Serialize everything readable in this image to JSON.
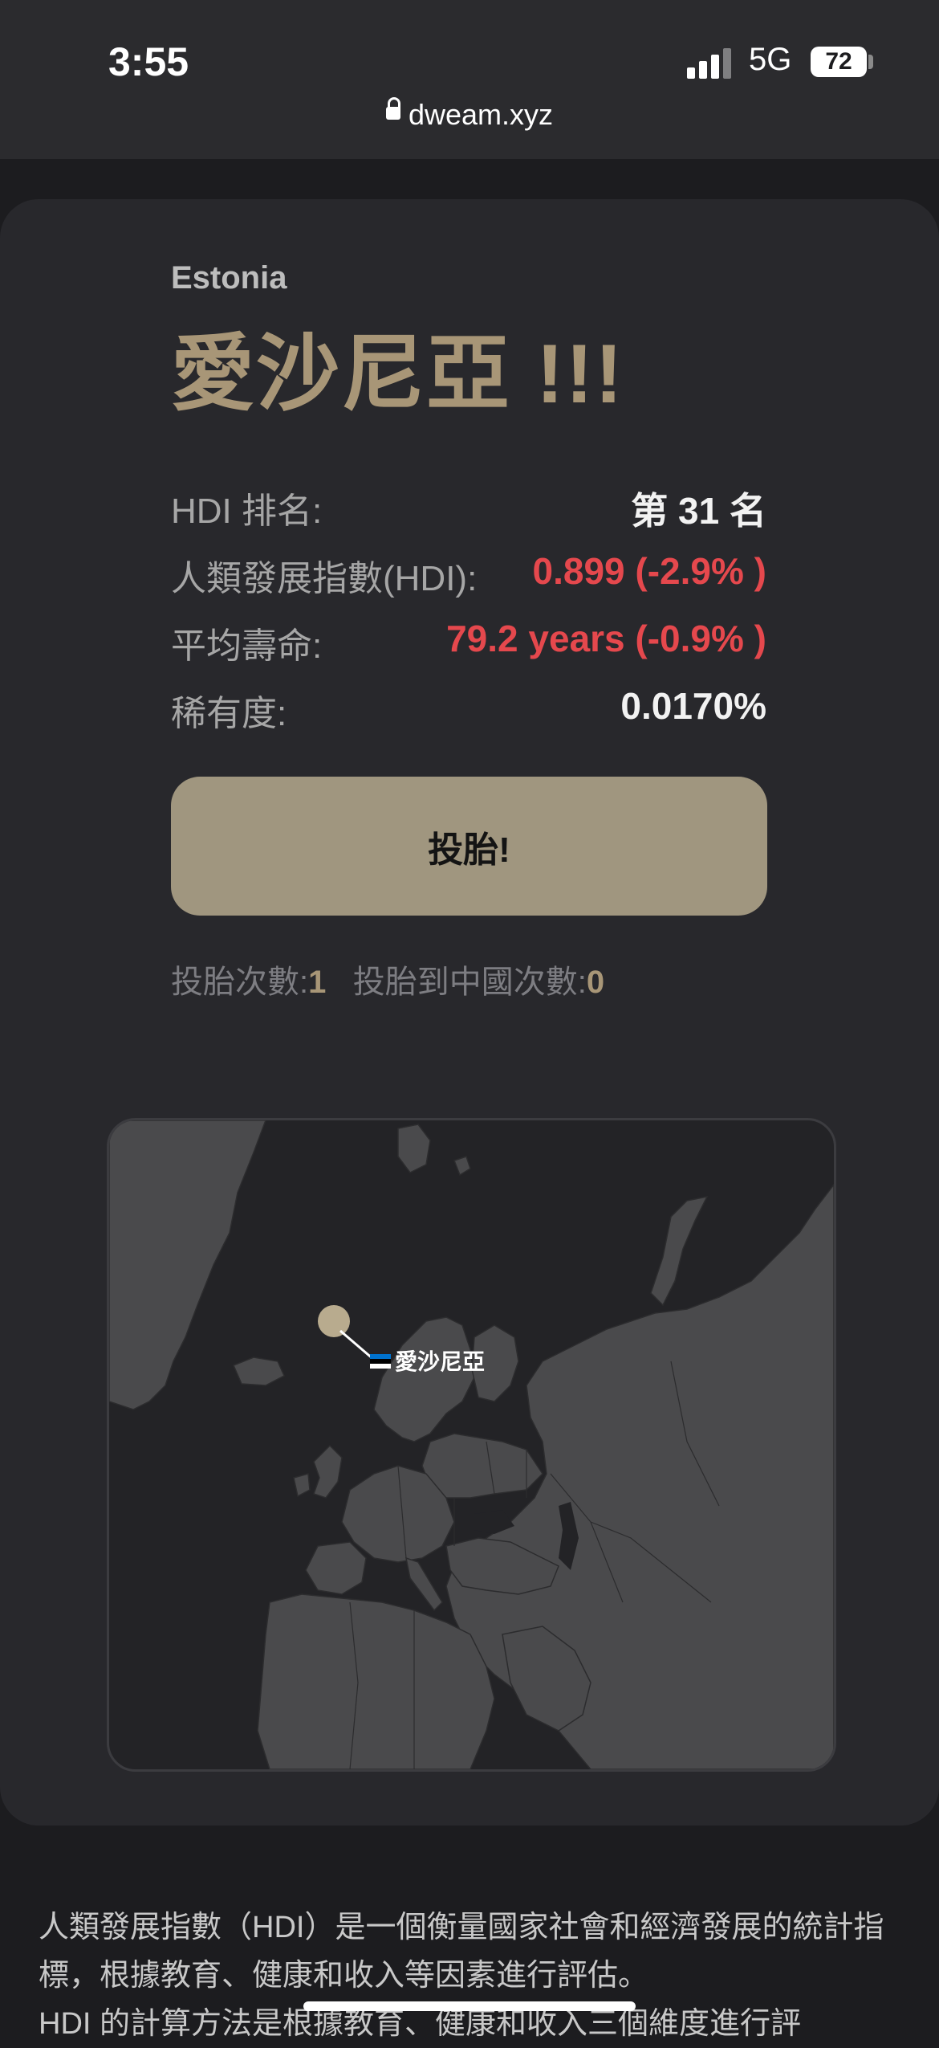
{
  "status_bar": {
    "time": "3:55",
    "network": "5G",
    "battery": "72",
    "battery_fraction": 0.72
  },
  "browser": {
    "url": "dweam.xyz"
  },
  "country": {
    "english_name": "Estonia",
    "title": "愛沙尼亞 !!!"
  },
  "stats": [
    {
      "label": "HDI 排名:",
      "value": "第 31 名",
      "color": "#f2f2f2"
    },
    {
      "label": "人類發展指數(HDI):",
      "value": "0.899 (-2.9% )",
      "color": "#e5484d"
    },
    {
      "label": "平均壽命:",
      "value": "79.2 years (-0.9% )",
      "color": "#e5484d"
    },
    {
      "label": "稀有度:",
      "value": "0.0170%",
      "color": "#f2f2f2"
    }
  ],
  "roll_button": {
    "label": "投胎!"
  },
  "counts": {
    "roll_label": "投胎次數:",
    "roll_value": "1",
    "china_label": "投胎到中國次數:",
    "china_value": "0"
  },
  "map": {
    "marker_label": "愛沙尼亞",
    "flag_colors": [
      "#0072ce",
      "#000000",
      "#ffffff"
    ],
    "land_color": "#4a4a4c",
    "sea_color": "#232326",
    "marker_color": "#b8ab8e"
  },
  "description": {
    "line1": "人類發展指數（HDI）是一個衡量國家社會和經濟發展的統計指標，根據教育、健康和收入等因素進行評估。",
    "line2": "HDI 的計算方法是根據教育、健康和收入三個維度進行評"
  },
  "colors": {
    "accent": "#a89677",
    "button": "#a0967f",
    "negative": "#e5484d",
    "card": "#28282c",
    "background": "#1c1c1f"
  }
}
